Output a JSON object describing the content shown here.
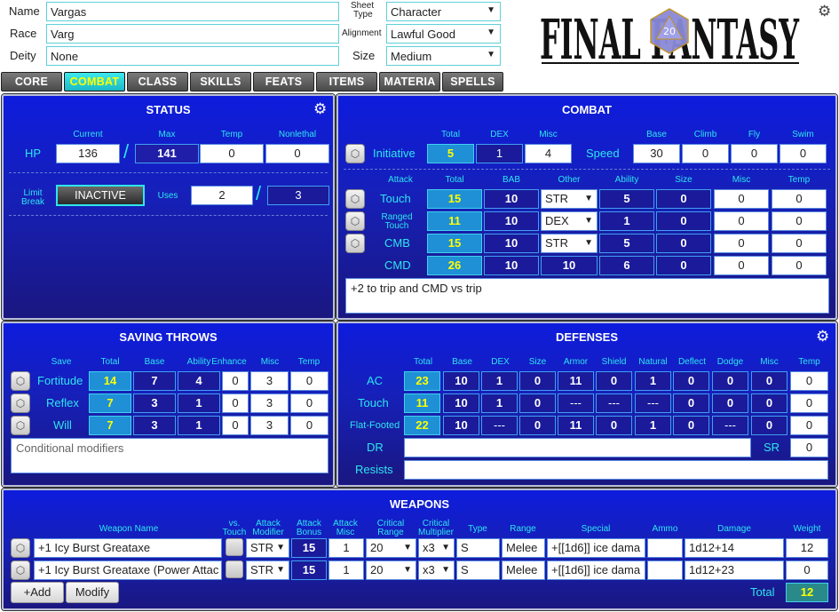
{
  "header": {
    "name_label": "Name",
    "name_value": "Vargas",
    "race_label": "Race",
    "race_value": "Varg",
    "deity_label": "Deity",
    "deity_value": "None",
    "sheet_type_label_1": "Sheet",
    "sheet_type_label_2": "Type",
    "sheet_type_value": "Character",
    "alignment_label": "Alignment",
    "alignment_value": "Lawful Good",
    "size_label": "Size",
    "size_value": "Medium",
    "logo_text": "FINAL FANTASY",
    "d20_face": "20"
  },
  "tabs": [
    "CORE",
    "COMBAT",
    "CLASS",
    "SKILLS",
    "FEATS",
    "ITEMS",
    "MATERIA",
    "SPELLS"
  ],
  "status": {
    "title": "STATUS",
    "cols": {
      "current": "Current",
      "max": "Max",
      "temp": "Temp",
      "nonlethal": "Nonlethal"
    },
    "hp_label": "HP",
    "hp_current": "136",
    "hp_max": "141",
    "hp_temp": "0",
    "hp_nonlethal": "0",
    "limit_label_1": "Limit",
    "limit_label_2": "Break",
    "limit_button": "INACTIVE",
    "uses_label": "Uses",
    "uses_current": "2",
    "uses_max": "3"
  },
  "combat": {
    "title": "COMBAT",
    "init_cols": {
      "total": "Total",
      "dex": "DEX",
      "misc": "Misc"
    },
    "initiative_label": "Initiative",
    "init_total": "5",
    "init_dex": "1",
    "init_misc": "4",
    "speed_cols": {
      "base": "Base",
      "climb": "Climb",
      "fly": "Fly",
      "swim": "Swim"
    },
    "speed_label": "Speed",
    "speed_base": "30",
    "speed_climb": "0",
    "speed_fly": "0",
    "speed_swim": "0",
    "attack_cols": {
      "attack": "Attack",
      "total": "Total",
      "bab": "BAB",
      "other": "Other",
      "ability": "Ability",
      "size": "Size",
      "misc": "Misc",
      "temp": "Temp"
    },
    "attacks": [
      {
        "label": "Touch",
        "total": "15",
        "bab": "10",
        "other": "STR",
        "ability": "5",
        "size": "0",
        "misc": "0",
        "temp": "0"
      },
      {
        "label": "Ranged Touch",
        "label_1": "Ranged",
        "label_2": "Touch",
        "total": "11",
        "bab": "10",
        "other": "DEX",
        "ability": "1",
        "size": "0",
        "misc": "0",
        "temp": "0"
      },
      {
        "label": "CMB",
        "total": "15",
        "bab": "10",
        "other": "STR",
        "ability": "5",
        "size": "0",
        "misc": "0",
        "temp": "0"
      },
      {
        "label": "CMD",
        "total": "26",
        "bab": "10",
        "other": "10",
        "ability": "6",
        "size": "0",
        "misc": "0",
        "temp": "0"
      }
    ],
    "notes": "+2 to trip and CMD vs trip"
  },
  "saves": {
    "title": "SAVING THROWS",
    "cols": {
      "save": "Save",
      "total": "Total",
      "base": "Base",
      "ability": "Ability",
      "enhance": "Enhance",
      "misc": "Misc",
      "temp": "Temp"
    },
    "rows": [
      {
        "label": "Fortitude",
        "total": "14",
        "base": "7",
        "ability": "4",
        "enhance": "0",
        "misc": "3",
        "temp": "0"
      },
      {
        "label": "Reflex",
        "total": "7",
        "base": "3",
        "ability": "1",
        "enhance": "0",
        "misc": "3",
        "temp": "0"
      },
      {
        "label": "Will",
        "total": "7",
        "base": "3",
        "ability": "1",
        "enhance": "0",
        "misc": "3",
        "temp": "0"
      }
    ],
    "conditional_placeholder": "Conditional modifiers"
  },
  "defenses": {
    "title": "DEFENSES",
    "cols": {
      "total": "Total",
      "base": "Base",
      "dex": "DEX",
      "size": "Size",
      "armor": "Armor",
      "shield": "Shield",
      "natural": "Natural",
      "deflect": "Deflect",
      "dodge": "Dodge",
      "misc": "Misc",
      "temp": "Temp"
    },
    "rows": [
      {
        "label": "AC",
        "total": "23",
        "base": "10",
        "dex": "1",
        "size": "0",
        "armor": "11",
        "shield": "0",
        "natural": "1",
        "deflect": "0",
        "dodge": "0",
        "misc": "0",
        "temp": "0"
      },
      {
        "label": "Touch",
        "total": "11",
        "base": "10",
        "dex": "1",
        "size": "0",
        "armor": "---",
        "shield": "---",
        "natural": "---",
        "deflect": "0",
        "dodge": "0",
        "misc": "0",
        "temp": "0"
      },
      {
        "label": "Flat-Footed",
        "total": "22",
        "base": "10",
        "dex": "---",
        "size": "0",
        "armor": "11",
        "shield": "0",
        "natural": "1",
        "deflect": "0",
        "dodge": "---",
        "misc": "0",
        "temp": "0"
      }
    ],
    "dr_label": "DR",
    "dr_value": "",
    "sr_label": "SR",
    "sr_value": "0",
    "resists_label": "Resists",
    "resists_value": ""
  },
  "weapons": {
    "title": "WEAPONS",
    "cols": {
      "name": "Weapon Name",
      "vs_1": "vs.",
      "vs_2": "Touch",
      "atk_mod_1": "Attack",
      "atk_mod_2": "Modifier",
      "atk_bonus_1": "Attack",
      "atk_bonus_2": "Bonus",
      "atk_misc_1": "Attack",
      "atk_misc_2": "Misc",
      "crit_range_1": "Critical",
      "crit_range_2": "Range",
      "crit_mult_1": "Critical",
      "crit_mult_2": "Multiplier",
      "type": "Type",
      "range": "Range",
      "special": "Special",
      "ammo": "Ammo",
      "damage": "Damage",
      "weight": "Weight"
    },
    "rows": [
      {
        "name": "+1 Icy Burst Greataxe",
        "mod": "STR",
        "bonus": "15",
        "misc": "1",
        "crit_range": "20",
        "crit_mult": "x3",
        "type": "S",
        "range": "Melee",
        "special": "+[[1d6]] ice dama",
        "ammo": "",
        "damage": "1d12+14",
        "weight": "12"
      },
      {
        "name": "+1 Icy Burst Greataxe (Power Attac",
        "mod": "STR",
        "bonus": "15",
        "misc": "1",
        "crit_range": "20",
        "crit_mult": "x3",
        "type": "S",
        "range": "Melee",
        "special": "+[[1d6]] ice dama",
        "ammo": "",
        "damage": "1d12+23",
        "weight": "0"
      }
    ],
    "add_button": "+Add",
    "modify_button": "Modify",
    "total_label": "Total",
    "total_weight": "12"
  },
  "colors": {
    "panel_blue": "#1620b8",
    "accent_cyan": "#2ee6ec",
    "active_tab": "#19b9c4",
    "total_yellow": "#ffff00"
  },
  "icons": {
    "settings": "gear-icon",
    "roll": "dice-icon"
  }
}
